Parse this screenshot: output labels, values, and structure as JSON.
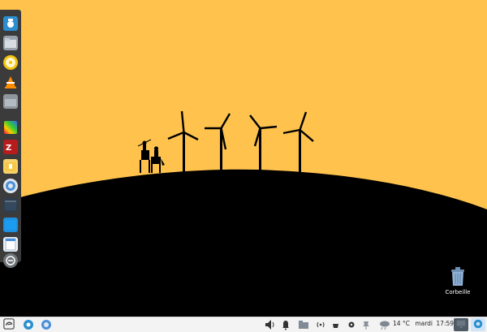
{
  "desktop": {
    "trash_label": "Corbeille"
  },
  "dock": {
    "items": [
      {
        "name": "app-store-icon"
      },
      {
        "name": "file-manager-icon"
      },
      {
        "name": "music-player-icon"
      },
      {
        "name": "vlc-icon"
      },
      {
        "name": "folder-icon"
      },
      {
        "name": "color-picker-icon"
      },
      {
        "name": "filezilla-icon"
      },
      {
        "name": "archive-manager-icon"
      },
      {
        "name": "browser-icon"
      },
      {
        "name": "terminal-icon"
      },
      {
        "name": "window-icon"
      },
      {
        "name": "notepad-icon"
      },
      {
        "name": "shutdown-icon"
      }
    ]
  },
  "taskbar": {
    "temperature": "14 °C",
    "day": "mardi",
    "time": "17:59"
  },
  "colors": {
    "sky": "#ffc34d",
    "hill": "#000000",
    "dock": "#3b3b3b",
    "taskbar": "#f3f3f3",
    "accent": "#2a8ed0"
  }
}
